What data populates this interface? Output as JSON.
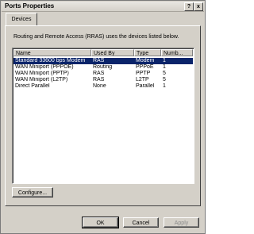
{
  "window": {
    "title": "Ports Properties"
  },
  "titlebar_buttons": {
    "help": "?",
    "close": "x"
  },
  "tabs": [
    {
      "label": "Devices"
    }
  ],
  "devices_tab": {
    "description": "Routing and Remote Access (RRAS) uses the devices listed below.",
    "columns": [
      "Name",
      "Used By",
      "Type",
      "Numb..."
    ],
    "rows": [
      {
        "name": "Standard 33600 bps Modem",
        "used_by": "RAS",
        "type": "Modem",
        "number": "1",
        "selected": true
      },
      {
        "name": "WAN Miniport (PPPOE)",
        "used_by": "Routing",
        "type": "PPPoE",
        "number": "1",
        "selected": false
      },
      {
        "name": "WAN Miniport (PPTP)",
        "used_by": "RAS",
        "type": "PPTP",
        "number": "5",
        "selected": false
      },
      {
        "name": "WAN Miniport (L2TP)",
        "used_by": "RAS",
        "type": "L2TP",
        "number": "5",
        "selected": false
      },
      {
        "name": "Direct Parallel",
        "used_by": "None",
        "type": "Parallel",
        "number": "1",
        "selected": false
      }
    ],
    "configure_label": "Configure..."
  },
  "buttons": {
    "ok": "OK",
    "cancel": "Cancel",
    "apply": "Apply"
  }
}
